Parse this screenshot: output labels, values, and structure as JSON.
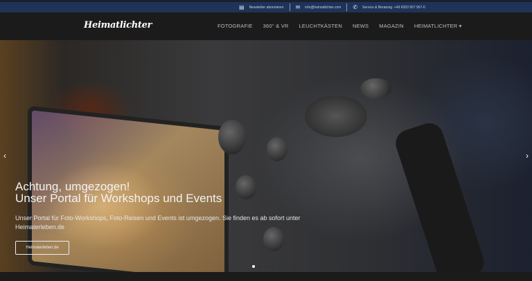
{
  "topbar": {
    "newsletter": {
      "icon": "newsletter-icon",
      "label": "Newsletter abonnieren"
    },
    "email": {
      "icon": "envelope-icon",
      "label": "info@heimatlichter.com"
    },
    "phone": {
      "icon": "phone-icon",
      "label": "Service & Beratung: +49 6353 957 957-0"
    }
  },
  "nav": {
    "logo": "Heimatlichter",
    "items": [
      "FOTOGRAFIE",
      "360° & VR",
      "LEUCHTKÄSTEN",
      "NEWS",
      "MAGAZIN",
      "HEIMATLICHTER ▾"
    ]
  },
  "hero": {
    "title_line1": "Achtung, umgezogen!",
    "title_line2": "Unser Portal für Workshops und Events",
    "text": "Unser Portal für Foto-Workshops, Foto-Reisen und Events ist umgezogen. Sie finden es ab sofort unter Heimaterleben.de",
    "button": "Heimaterleben.de",
    "prev": "‹",
    "next": "›",
    "slides_total": 4,
    "active_slide": 1
  }
}
